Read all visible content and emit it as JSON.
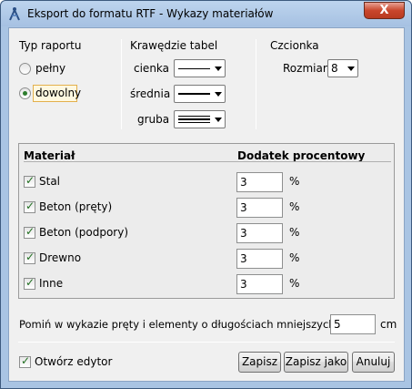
{
  "window": {
    "title": "Eksport do formatu RTF - Wykazy materiałów",
    "close_glyph": "X",
    "app_icon": "compass-icon"
  },
  "report_type": {
    "heading": "Typ raportu",
    "options": [
      "pełny",
      "dowolny"
    ],
    "selected": "dowolny"
  },
  "table_borders": {
    "heading": "Krawędzie tabel",
    "rows": [
      {
        "label": "cienka",
        "line": "thin"
      },
      {
        "label": "średnia",
        "line": "medium"
      },
      {
        "label": "gruba",
        "line": "thick-triple"
      }
    ]
  },
  "font": {
    "heading": "Czcionka",
    "size_label": "Rozmiar",
    "size_value": "8"
  },
  "materials": {
    "col_material": "Materiał",
    "col_percent": "Dodatek procentowy",
    "unit": "%",
    "rows": [
      {
        "name": "Stal",
        "checked": true,
        "value": "3"
      },
      {
        "name": "Beton (pręty)",
        "checked": true,
        "value": "3"
      },
      {
        "name": "Beton (podpory)",
        "checked": true,
        "value": "3"
      },
      {
        "name": "Drewno",
        "checked": true,
        "value": "3"
      },
      {
        "name": "Inne",
        "checked": true,
        "value": "3"
      }
    ]
  },
  "skip": {
    "label": "Pomiń w wykazie pręty i elementy o długościach mniejszych niż",
    "value": "5",
    "unit": "cm"
  },
  "open_editor": {
    "label": "Otwórz edytor",
    "checked": true
  },
  "buttons": {
    "save": "Zapisz",
    "save_as": "Zapisz jako",
    "cancel": "Anuluj"
  }
}
